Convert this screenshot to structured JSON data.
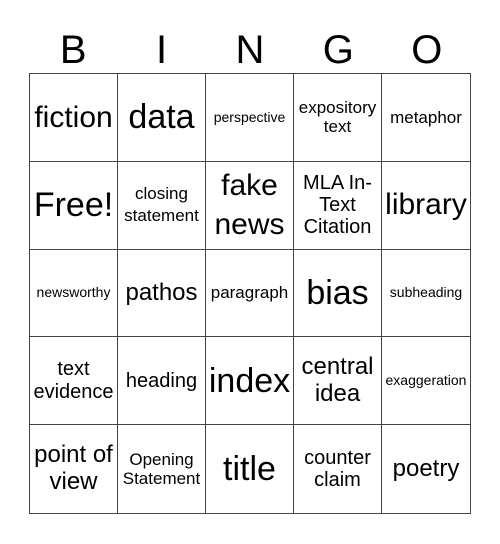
{
  "header": {
    "letters": [
      "B",
      "I",
      "N",
      "G",
      "O"
    ]
  },
  "cells": [
    "fiction",
    "data",
    "perspective",
    "expository text",
    "metaphor",
    "Free!",
    "closing statement",
    "fake news",
    "MLA In-Text Citation",
    "library",
    "newsworthy",
    "pathos",
    "paragraph",
    "bias",
    "subheading",
    "text evidence",
    "heading",
    "index",
    "central idea",
    "exaggeration",
    "point of view",
    "Opening Statement",
    "title",
    "counter claim",
    "poetry"
  ]
}
